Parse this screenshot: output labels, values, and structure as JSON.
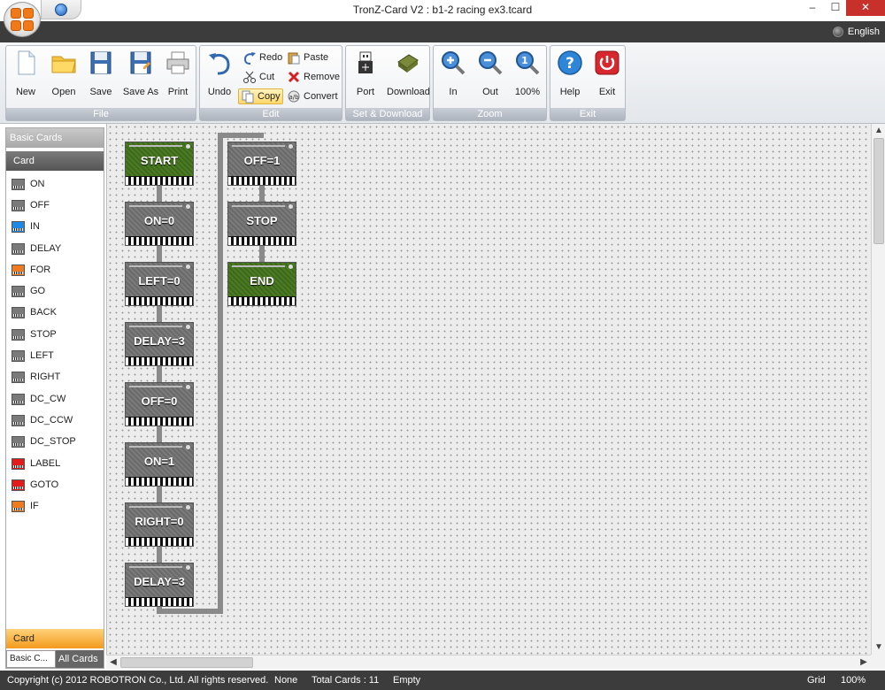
{
  "window": {
    "title": "TronZ-Card V2 : b1-2 racing ex3.tcard",
    "minimize": "–",
    "maximize": "☐",
    "close": "✕"
  },
  "language": "English",
  "ribbon": {
    "file": {
      "label": "File",
      "new": "New",
      "open": "Open",
      "save": "Save",
      "save_as": "Save As",
      "print": "Print"
    },
    "edit": {
      "label": "Edit",
      "undo": "Undo",
      "redo": "Redo",
      "cut": "Cut",
      "copy": "Copy",
      "paste": "Paste",
      "remove": "Remove",
      "convert": "Convert"
    },
    "set_download": {
      "label": "Set & Download",
      "port": "Port",
      "download": "Download"
    },
    "zoom": {
      "label": "Zoom",
      "in": "In",
      "out": "Out",
      "percent": "100%"
    },
    "exit": {
      "label": "Exit",
      "help": "Help",
      "exit": "Exit"
    }
  },
  "sidebar": {
    "header": "Basic Cards",
    "section": "Card",
    "items": [
      {
        "label": "ON",
        "color": "gray"
      },
      {
        "label": "OFF",
        "color": "gray"
      },
      {
        "label": "IN",
        "color": "blue"
      },
      {
        "label": "DELAY",
        "color": "gray"
      },
      {
        "label": "FOR",
        "color": "orange"
      },
      {
        "label": "GO",
        "color": "gray"
      },
      {
        "label": "BACK",
        "color": "gray"
      },
      {
        "label": "STOP",
        "color": "gray"
      },
      {
        "label": "LEFT",
        "color": "gray"
      },
      {
        "label": "RIGHT",
        "color": "gray"
      },
      {
        "label": "DC_CW",
        "color": "gray"
      },
      {
        "label": "DC_CCW",
        "color": "gray"
      },
      {
        "label": "DC_STOP",
        "color": "gray"
      },
      {
        "label": "LABEL",
        "color": "red"
      },
      {
        "label": "GOTO",
        "color": "red"
      },
      {
        "label": "IF",
        "color": "orange"
      }
    ],
    "bottom_tab": "Card",
    "tabs": [
      "Basic C...",
      "All Cards"
    ]
  },
  "canvas": {
    "cards": [
      {
        "label": "START",
        "style": "green"
      },
      {
        "label": "ON=0",
        "style": "gray"
      },
      {
        "label": "LEFT=0",
        "style": "gray"
      },
      {
        "label": "DELAY=3",
        "style": "gray"
      },
      {
        "label": "OFF=0",
        "style": "gray"
      },
      {
        "label": "ON=1",
        "style": "gray"
      },
      {
        "label": "RIGHT=0",
        "style": "gray"
      },
      {
        "label": "DELAY=3",
        "style": "gray"
      },
      {
        "label": "OFF=1",
        "style": "gray"
      },
      {
        "label": "STOP",
        "style": "gray"
      },
      {
        "label": "END",
        "style": "green"
      }
    ]
  },
  "status": {
    "copyright": "Copyright (c) 2012 ROBOTRON Co., Ltd.  All rights reserved.",
    "mode": "None",
    "total_cards": "Total Cards : 11",
    "clipboard": "Empty",
    "grid": "Grid",
    "zoom": "100%"
  },
  "colors": {
    "dark_band": "#3c3c3c",
    "card_green": "#4c7a24",
    "card_gray": "#6e6e6e",
    "accent_orange": "#f39a1c",
    "close_red": "#c7302b"
  }
}
